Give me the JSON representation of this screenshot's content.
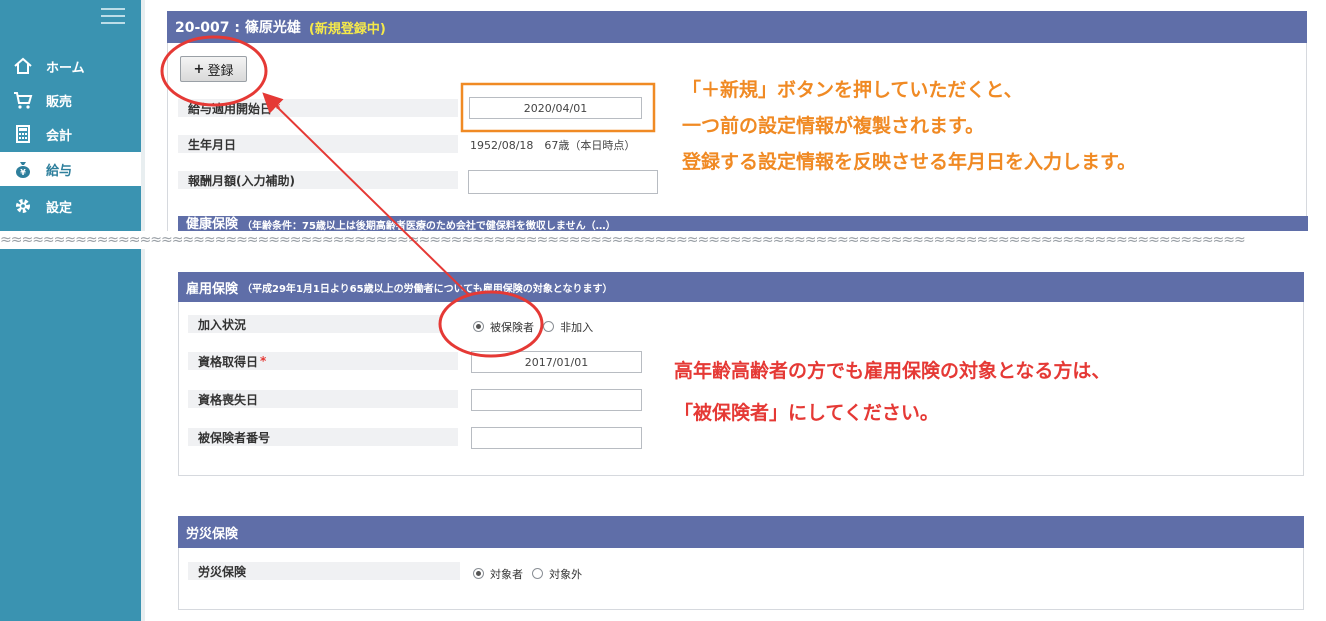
{
  "sidebar": {
    "items": [
      {
        "label": "ホーム",
        "icon": "home-icon"
      },
      {
        "label": "販売",
        "icon": "cart-icon"
      },
      {
        "label": "会計",
        "icon": "calculator-icon"
      },
      {
        "label": "給与",
        "icon": "moneybag-icon",
        "active": true
      },
      {
        "label": "設定",
        "icon": "gear-icon"
      }
    ]
  },
  "header": {
    "title": "20-007 : 篠原光雄",
    "status": "(新規登録中)"
  },
  "toolbar": {
    "register_label": "登録"
  },
  "salary": {
    "start_label": "給与適用開始日",
    "start_value": "2020/04/01",
    "birth_label": "生年月日",
    "birth_value": "1952/08/18　67歳（本日時点）",
    "monthly_label": "報酬月額(入力補助)",
    "health_title": "健康保険",
    "health_note": "（年齢条件：75歳以上は後期高齢者医療のため会社で健保料を徴収しません（…）"
  },
  "employment": {
    "title": "雇用保険",
    "note": "（平成29年1月1日より65歳以上の労働者についても雇用保険の対象となります）",
    "status_label": "加入状況",
    "opt_insured": "被保険者",
    "opt_not": "非加入",
    "acquire_label": "資格取得日",
    "acquire_value": "2017/01/01",
    "loss_label": "資格喪失日",
    "number_label": "被保険者番号"
  },
  "workers": {
    "title": "労災保険",
    "label": "労災保険",
    "opt_target": "対象者",
    "opt_excluded": "対象外"
  },
  "annotations": {
    "top_line1": "「＋新規」ボタンを押していただくと、",
    "top_line2": "一つ前の設定情報が複製されます。",
    "top_line3": "登録する設定情報を反映させる年月日を入力します。",
    "bottom_line1": "高年齢高齢者の方でも雇用保険の対象となる方は、",
    "bottom_line2": "「被保険者」にしてください。"
  },
  "colors": {
    "sidebar": "#3a93b1",
    "panel_header": "#5f6ea8",
    "status_yellow": "#f5e94a",
    "annot_orange": "#f08a24",
    "annot_red": "#e53935"
  }
}
